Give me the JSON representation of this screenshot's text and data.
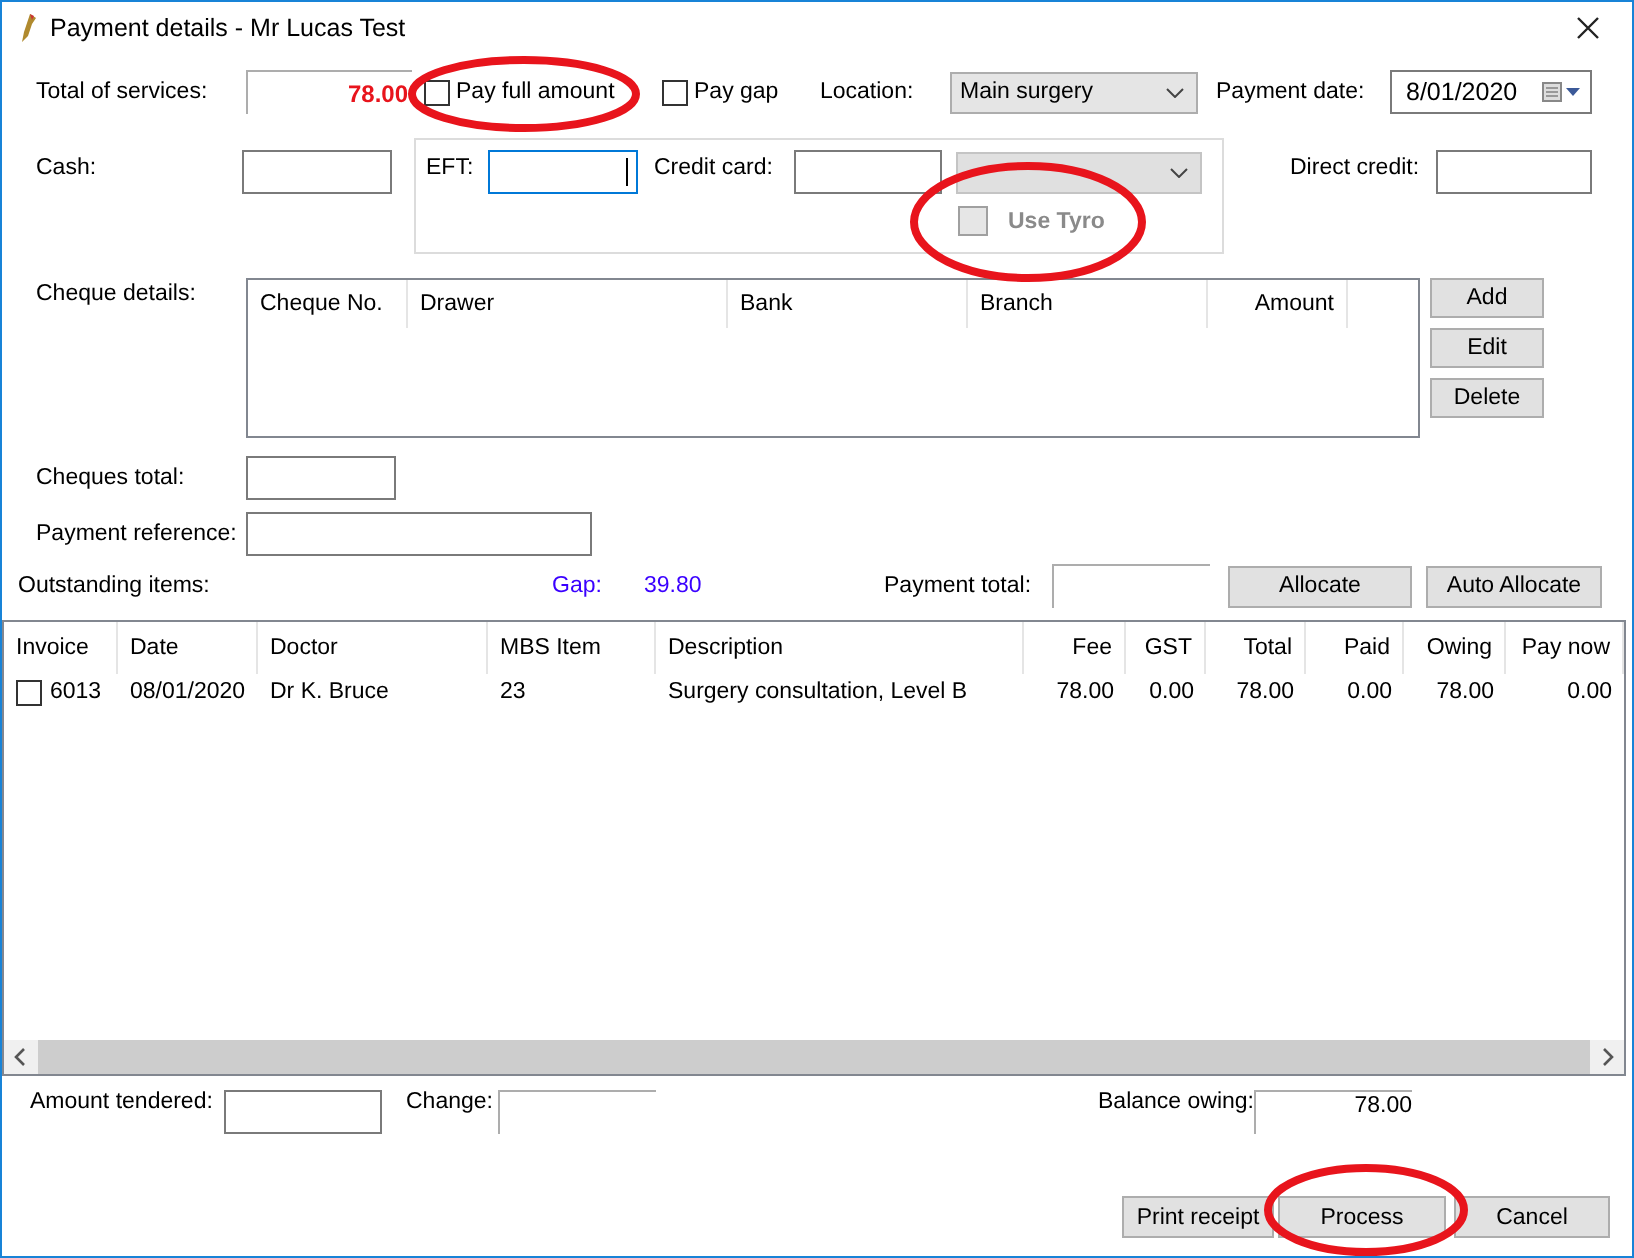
{
  "window": {
    "title": "Payment details - Mr Lucas Test"
  },
  "total_of_services": {
    "label": "Total of services:",
    "value": "78.00"
  },
  "pay_full_amount": {
    "label": "Pay full amount",
    "checked": false
  },
  "pay_gap": {
    "label": "Pay gap",
    "checked": false
  },
  "location": {
    "label": "Location:",
    "value": "Main surgery"
  },
  "payment_date": {
    "label": "Payment date:",
    "value": "8/01/2020"
  },
  "cash": {
    "label": "Cash:"
  },
  "eft": {
    "label": "EFT:"
  },
  "credit_card": {
    "label": "Credit card:"
  },
  "use_tyro": {
    "label": "Use Tyro",
    "checked": false,
    "disabled": true
  },
  "direct_credit": {
    "label": "Direct credit:"
  },
  "cheque_details": {
    "label": "Cheque details:",
    "columns": [
      {
        "label": "Cheque No.",
        "kind": "text"
      },
      {
        "label": "Drawer",
        "kind": "text"
      },
      {
        "label": "Bank",
        "kind": "text"
      },
      {
        "label": "Branch",
        "kind": "text"
      },
      {
        "label": "Amount",
        "kind": "number"
      }
    ]
  },
  "cheque_buttons": [
    "Add",
    "Edit",
    "Delete"
  ],
  "cheques_total": {
    "label": "Cheques total:"
  },
  "payment_reference": {
    "label": "Payment reference:"
  },
  "outstanding_items": {
    "label": "Outstanding items:",
    "gap_label": "Gap:",
    "gap_value": "39.80"
  },
  "payment_total": {
    "label": "Payment total:"
  },
  "allocate_buttons": [
    "Allocate",
    "Auto Allocate"
  ],
  "items_table": {
    "columns": [
      {
        "label": "Invoice",
        "kind": "text"
      },
      {
        "label": "Date",
        "kind": "text"
      },
      {
        "label": "Doctor",
        "kind": "text"
      },
      {
        "label": "MBS Item",
        "kind": "text"
      },
      {
        "label": "Description",
        "kind": "text"
      },
      {
        "label": "Fee",
        "kind": "number"
      },
      {
        "label": "GST",
        "kind": "number"
      },
      {
        "label": "Total",
        "kind": "number"
      },
      {
        "label": "Paid",
        "kind": "number"
      },
      {
        "label": "Owing",
        "kind": "number"
      },
      {
        "label": "Pay now",
        "kind": "number"
      }
    ],
    "rows": [
      {
        "checked": false,
        "cells": [
          "6013",
          "08/01/2020",
          "Dr K. Bruce",
          "23",
          "Surgery consultation, Level B",
          "78.00",
          "0.00",
          "78.00",
          "0.00",
          "78.00",
          "0.00"
        ]
      }
    ]
  },
  "amount_tendered": {
    "label": "Amount tendered:"
  },
  "change": {
    "label": "Change:"
  },
  "balance_owing": {
    "label": "Balance owing:",
    "value": "78.00"
  },
  "buttons": [
    "Print receipt",
    "Process",
    "Cancel"
  ]
}
